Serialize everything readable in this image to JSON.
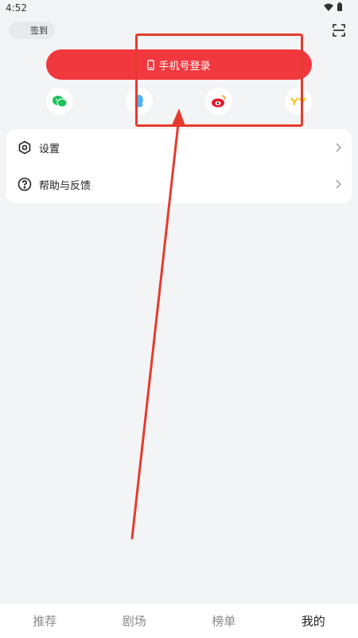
{
  "status_bar": {
    "time": "4:52",
    "icons": [
      "wifi-icon",
      "battery-icon"
    ]
  },
  "header": {
    "checkin_label": "签到",
    "scan_icon": "scan-icon"
  },
  "login": {
    "phone_login_label": "手机号登录",
    "phone_icon": "phone-icon"
  },
  "social_login": [
    {
      "name": "wechat-icon",
      "color": "#1ec25a"
    },
    {
      "name": "qq-icon",
      "color": "#4fb3ea"
    },
    {
      "name": "weibo-icon",
      "color": "#e6162d"
    },
    {
      "name": "yy-icon",
      "color": "#f5c400"
    }
  ],
  "menu": {
    "items": [
      {
        "label": "设置",
        "icon": "settings-icon"
      },
      {
        "label": "帮助与反馈",
        "icon": "help-icon"
      }
    ]
  },
  "tabbar": {
    "tabs": [
      {
        "label": "推荐",
        "active": false
      },
      {
        "label": "剧场",
        "active": false
      },
      {
        "label": "榜单",
        "active": false
      },
      {
        "label": "我的",
        "active": true
      }
    ]
  },
  "colors": {
    "accent": "#f2383f",
    "annotation": "#e53b2e",
    "background": "#f3f4f6"
  }
}
